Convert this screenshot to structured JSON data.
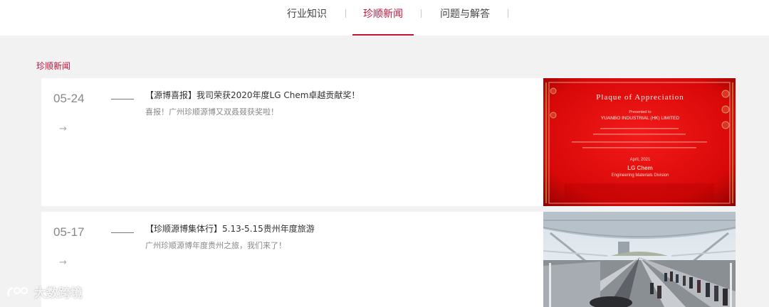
{
  "nav": {
    "tabs": [
      {
        "label": "行业知识",
        "active": false
      },
      {
        "label": "珍顺新闻",
        "active": true
      },
      {
        "label": "问题与解答",
        "active": false
      }
    ]
  },
  "section": {
    "title": "珍顺新闻"
  },
  "news": [
    {
      "date": "05-24",
      "title": "【源博喜报】我司荣获2020年度LG Chem卓越贡献奖！",
      "summary": "喜报！广州珍顺源博又双叒叕获奖啦！",
      "arrow": "→",
      "image": {
        "heading": "Plaque of Appreciation",
        "presented_to": "Presented to",
        "company": "YUANBO INDUSTRIAL (HK) LIMITED",
        "date_line": "April, 2021",
        "brand": "LG Chem",
        "division": "Engineering Materials Division"
      }
    },
    {
      "date": "05-17",
      "title": "【珍顺源博集体行】5.13-5.15贵州年度旅游",
      "summary": "广州珍顺源博年度贵州之旅，我们来了！",
      "arrow": "→"
    }
  ],
  "watermark": {
    "text": "大数跨境"
  },
  "colors": {
    "accent": "#c4143c",
    "background": "#f2f2f2",
    "card": "#ffffff"
  }
}
